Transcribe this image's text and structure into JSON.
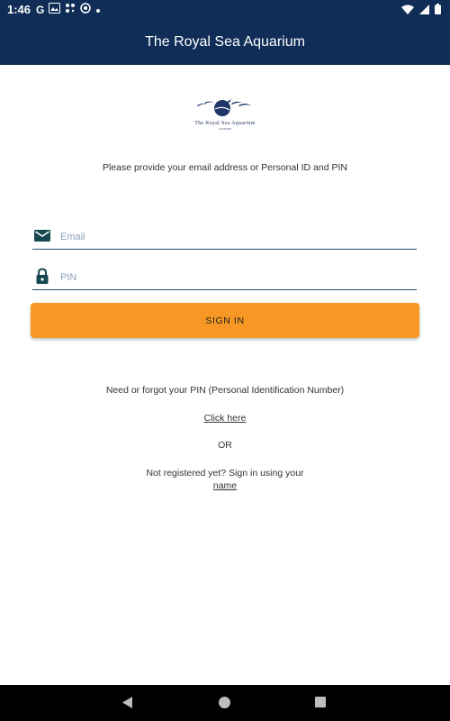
{
  "status_bar": {
    "time": "1:46",
    "left_icons": [
      "g-icon",
      "photo-icon",
      "dots-icon",
      "blocked-icon",
      "dot-icon"
    ],
    "right_icons": [
      "wifi-icon",
      "signal-icon",
      "battery-icon"
    ]
  },
  "app_bar": {
    "title": "The Royal Sea Aquarium"
  },
  "logo": {
    "wordmark": "The Royal Sea Aquarium",
    "sub": "ALESUND"
  },
  "login": {
    "instructions": "Please provide your email address or Personal ID and PIN",
    "email_placeholder": "Email",
    "pin_placeholder": "PIN",
    "sign_in_label": "SIGN IN"
  },
  "help": {
    "forgot_text": "Need or forgot your PIN (Personal Identification Number)",
    "click_here": "Click here",
    "or_text": "OR",
    "not_registered_text": "Not registered yet? Sign in using your",
    "name_link": "name"
  },
  "colors": {
    "header_bg": "#0f2d57",
    "accent": "#f69823",
    "icon_teal": "#17474f"
  }
}
